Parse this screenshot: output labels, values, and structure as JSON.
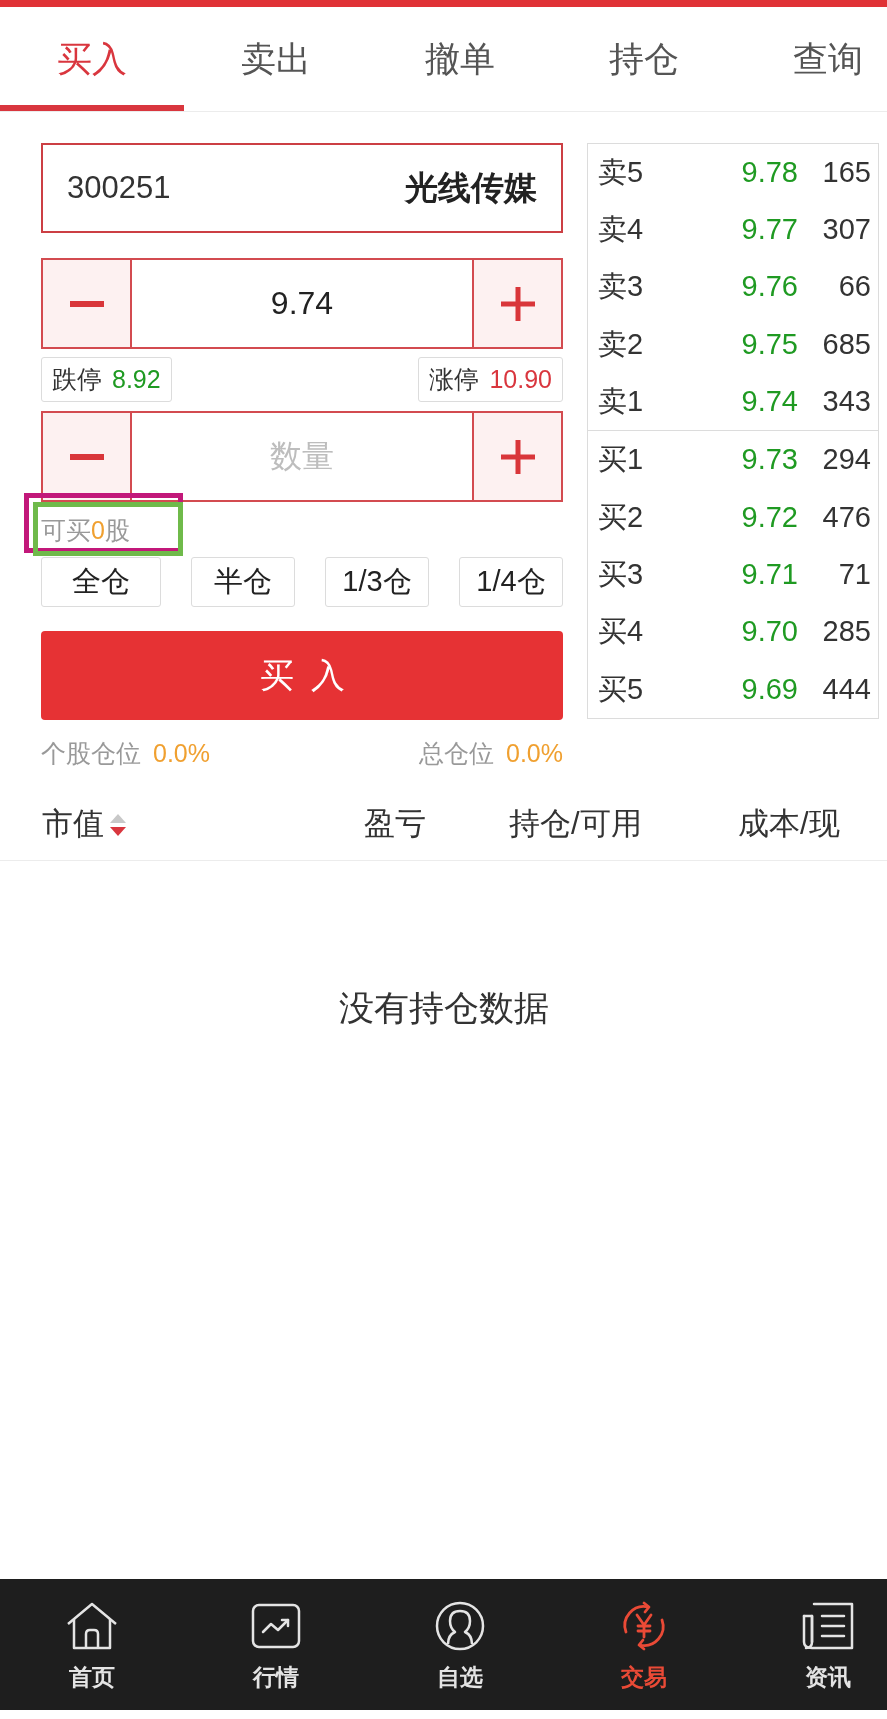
{
  "top_tabs": [
    {
      "label": "买入",
      "selected": true
    },
    {
      "label": "卖出",
      "selected": false
    },
    {
      "label": "撤单",
      "selected": false
    },
    {
      "label": "持仓",
      "selected": false
    },
    {
      "label": "查询",
      "selected": false
    }
  ],
  "order_form": {
    "stock_code": "300251",
    "stock_name": "光线传媒",
    "price": "9.74",
    "limit_down": {
      "label": "跌停",
      "value": "8.92"
    },
    "limit_up": {
      "label": "涨停",
      "value": "10.90"
    },
    "quantity": {
      "placeholder": "数量"
    },
    "available": {
      "before": "可买",
      "count": "0",
      "after": "股"
    },
    "position_buttons": [
      "全仓",
      "半仓",
      "1/3仓",
      "1/4仓"
    ],
    "submit_button": "买入",
    "stock_position": {
      "label": "个股仓位",
      "value": "0.0%"
    },
    "total_position": {
      "label": "总仓位",
      "value": "0.0%"
    }
  },
  "order_book": {
    "asks": [
      {
        "label": "卖5",
        "price": "9.78",
        "volume": "165"
      },
      {
        "label": "卖4",
        "price": "9.77",
        "volume": "307"
      },
      {
        "label": "卖3",
        "price": "9.76",
        "volume": "66"
      },
      {
        "label": "卖2",
        "price": "9.75",
        "volume": "685"
      },
      {
        "label": "卖1",
        "price": "9.74",
        "volume": "343"
      }
    ],
    "bids": [
      {
        "label": "买1",
        "price": "9.73",
        "volume": "294"
      },
      {
        "label": "买2",
        "price": "9.72",
        "volume": "476"
      },
      {
        "label": "买3",
        "price": "9.71",
        "volume": "71"
      },
      {
        "label": "买4",
        "price": "9.70",
        "volume": "285"
      },
      {
        "label": "买5",
        "price": "9.69",
        "volume": "444"
      }
    ]
  },
  "holdings": {
    "columns": [
      {
        "label": "市值",
        "sort_descending": true
      },
      {
        "label": "盈亏"
      },
      {
        "label": "持仓/可用"
      },
      {
        "label": "成本/现"
      }
    ],
    "empty_message": "没有持仓数据"
  },
  "bottom_nav": [
    {
      "label": "首页",
      "selected": false
    },
    {
      "label": "行情",
      "selected": false
    },
    {
      "label": "自选",
      "selected": false
    },
    {
      "label": "交易",
      "selected": true
    },
    {
      "label": "资讯",
      "selected": false
    }
  ],
  "highlight_frames": [
    {
      "color": "#c2187a"
    },
    {
      "color": "#6fba4a"
    }
  ]
}
